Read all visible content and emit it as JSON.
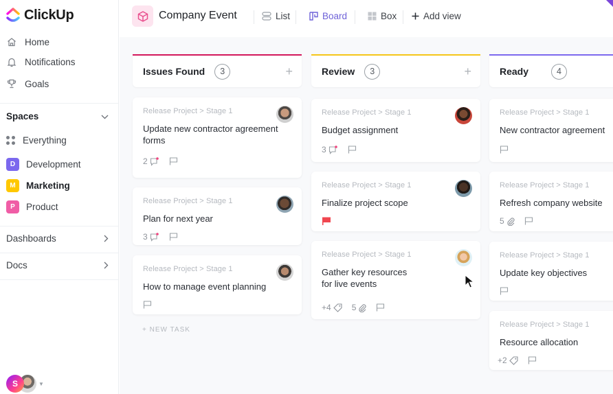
{
  "app": {
    "name": "ClickUp"
  },
  "sidebar": {
    "nav": [
      {
        "label": "Home",
        "icon": "home-icon"
      },
      {
        "label": "Notifications",
        "icon": "bell-icon"
      },
      {
        "label": "Goals",
        "icon": "trophy-icon"
      }
    ],
    "spaces_title": "Spaces",
    "spaces": [
      {
        "label": "Everything",
        "icon": "grid-dots-icon"
      },
      {
        "label": "Development",
        "badge": "D",
        "color": "#7b68ee"
      },
      {
        "label": "Marketing",
        "badge": "M",
        "color": "#ffc800",
        "active": true
      },
      {
        "label": "Product",
        "badge": "P",
        "color": "#f05da6"
      }
    ],
    "dashboards": "Dashboards",
    "docs": "Docs",
    "user_initial": "S"
  },
  "header": {
    "project_title": "Company Event",
    "views": [
      {
        "label": "List",
        "icon": "list-icon"
      },
      {
        "label": "Board",
        "icon": "board-icon",
        "active": true
      },
      {
        "label": "Box",
        "icon": "box-icon"
      },
      {
        "label": "Add view",
        "icon": "plus-icon"
      }
    ]
  },
  "colors": {
    "accent": "#6e62d8",
    "issues": "#d3175b",
    "review": "#f5c518",
    "ready": "#7b68ee",
    "flag_red": "#f0464f",
    "notify_dot": "#f0457f"
  },
  "board": {
    "columns": [
      {
        "title": "Issues Found",
        "count": "3",
        "color": "#d3175b",
        "cards": [
          {
            "crumb": "Release Project > Stage 1",
            "title": "Update new contractor agreement forms",
            "comments": "2"
          },
          {
            "crumb": "Release Project > Stage 1",
            "title": "Plan for next year",
            "comments": "3"
          },
          {
            "crumb": "Release Project > Stage 1",
            "title": "How to manage event planning"
          }
        ],
        "new_task": "+ NEW TASK"
      },
      {
        "title": "Review",
        "count": "3",
        "color": "#f5c518",
        "cards": [
          {
            "crumb": "Release Project > Stage 1",
            "title": "Budget assignment",
            "comments": "3"
          },
          {
            "crumb": "Release Project > Stage 1",
            "title": "Finalize project scope",
            "flag": "urgent"
          },
          {
            "crumb": "Release Project > Stage 1",
            "title": "Gather key resources for live events",
            "tags": "+4",
            "attachments": "5"
          }
        ]
      },
      {
        "title": "Ready",
        "count": "4",
        "color": "#7b68ee",
        "cards": [
          {
            "crumb": "Release Project > Stage 1",
            "title": "New contractor agreement"
          },
          {
            "crumb": "Release Project > Stage 1",
            "title": "Refresh company website",
            "attachments": "5"
          },
          {
            "crumb": "Release Project > Stage 1",
            "title": "Update key objectives"
          },
          {
            "crumb": "Release Project > Stage 1",
            "title": "Resource allocation",
            "tags": "+2"
          }
        ]
      }
    ]
  }
}
